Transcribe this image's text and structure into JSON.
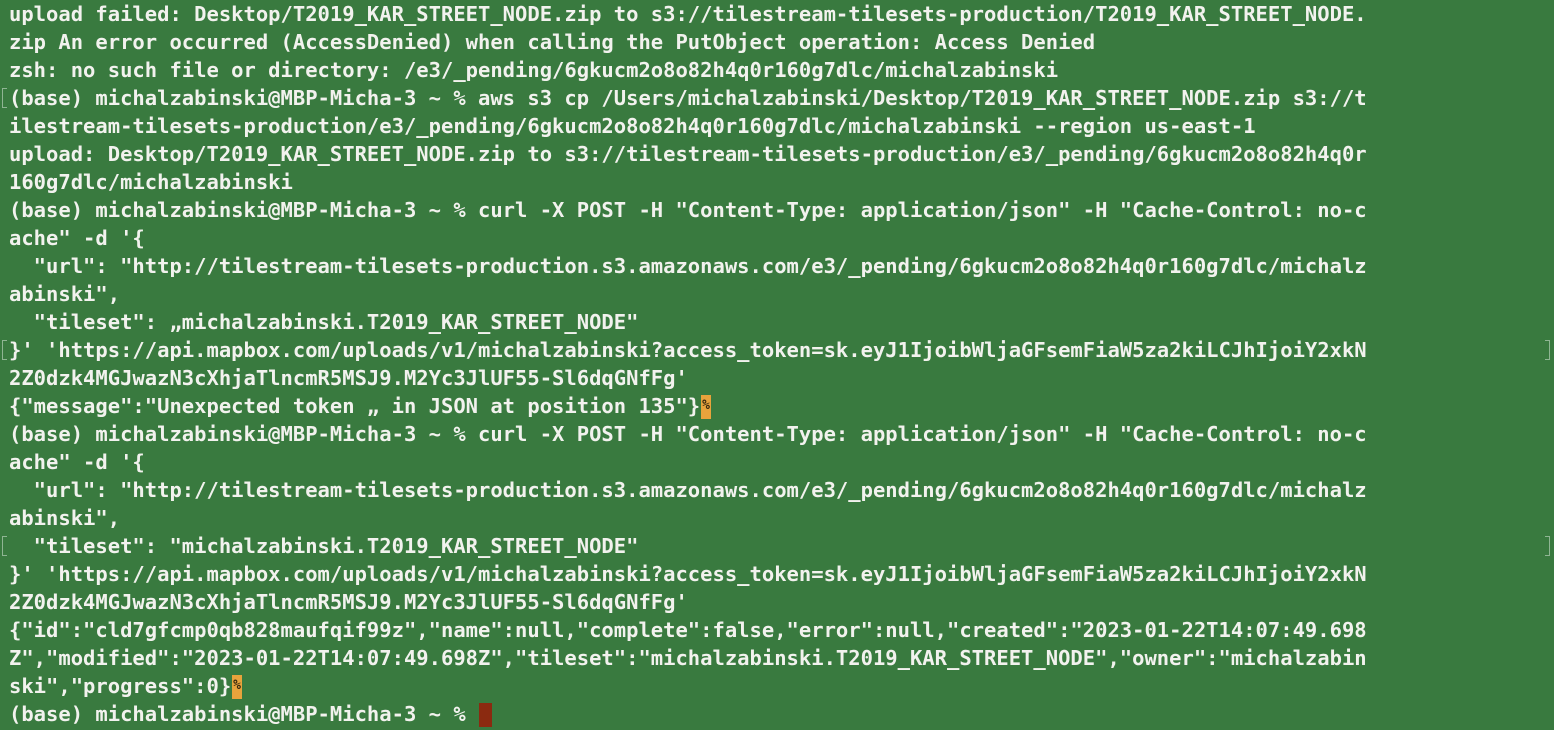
{
  "terminal": {
    "lines": [
      "upload failed: Desktop/T2019_KAR_STREET_NODE.zip to s3://tilestream-tilesets-production/T2019_KAR_STREET_NODE.",
      "zip An error occurred (AccessDenied) when calling the PutObject operation: Access Denied",
      "zsh: no such file or directory: /e3/_pending/6gkucm2o8o82h4q0r160g7dlc/michalzabinski",
      "(base) michalzabinski@MBP-Micha-3 ~ % aws s3 cp /Users/michalzabinski/Desktop/T2019_KAR_STREET_NODE.zip s3://t",
      "ilestream-tilesets-production/e3/_pending/6gkucm2o8o82h4q0r160g7dlc/michalzabinski --region us-east-1",
      "upload: Desktop/T2019_KAR_STREET_NODE.zip to s3://tilestream-tilesets-production/e3/_pending/6gkucm2o8o82h4q0r",
      "160g7dlc/michalzabinski",
      "(base) michalzabinski@MBP-Micha-3 ~ % curl -X POST -H \"Content-Type: application/json\" -H \"Cache-Control: no-c",
      "ache\" -d '{",
      "  \"url\": \"http://tilestream-tilesets-production.s3.amazonaws.com/e3/_pending/6gkucm2o8o82h4q0r160g7dlc/michalz",
      "abinski\",",
      "  \"tileset\": „michalzabinski.T2019_KAR_STREET_NODE\"",
      "}' 'https://api.mapbox.com/uploads/v1/michalzabinski?access_token=sk.eyJ1IjoibWljaGFsemFiaW5za2kiLCJhIjoiY2xkN",
      "2Z0dzk4MGJwazN3cXhjaTlncmR5MSJ9.M2Yc3JlUF55-Sl6dqGNfFg'",
      "{\"message\":\"Unexpected token „ in JSON at position 135\"}",
      "(base) michalzabinski@MBP-Micha-3 ~ % curl -X POST -H \"Content-Type: application/json\" -H \"Cache-Control: no-c",
      "ache\" -d '{",
      "  \"url\": \"http://tilestream-tilesets-production.s3.amazonaws.com/e3/_pending/6gkucm2o8o82h4q0r160g7dlc/michalz",
      "abinski\",",
      "  \"tileset\": \"michalzabinski.T2019_KAR_STREET_NODE\"",
      "}' 'https://api.mapbox.com/uploads/v1/michalzabinski?access_token=sk.eyJ1IjoibWljaGFsemFiaW5za2kiLCJhIjoiY2xkN",
      "2Z0dzk4MGJwazN3cXhjaTlncmR5MSJ9.M2Yc3JlUF55-Sl6dqGNfFg'",
      "{\"id\":\"cld7gfcmp0qb828maufqif99z\",\"name\":null,\"complete\":false,\"error\":null,\"created\":\"2023-01-22T14:07:49.698",
      "Z\",\"modified\":\"2023-01-22T14:07:49.698Z\",\"tileset\":\"michalzabinski.T2019_KAR_STREET_NODE\",\"owner\":\"michalzabin",
      "ski\",\"progress\":0}",
      "(base) michalzabinski@MBP-Micha-3 ~ % "
    ],
    "eol_mark": "%",
    "colors": {
      "background": "#397a3f",
      "foreground": "#f2f2ee",
      "eol_mark_bg": "#e8a33c",
      "cursor": "#8b2a10"
    }
  }
}
